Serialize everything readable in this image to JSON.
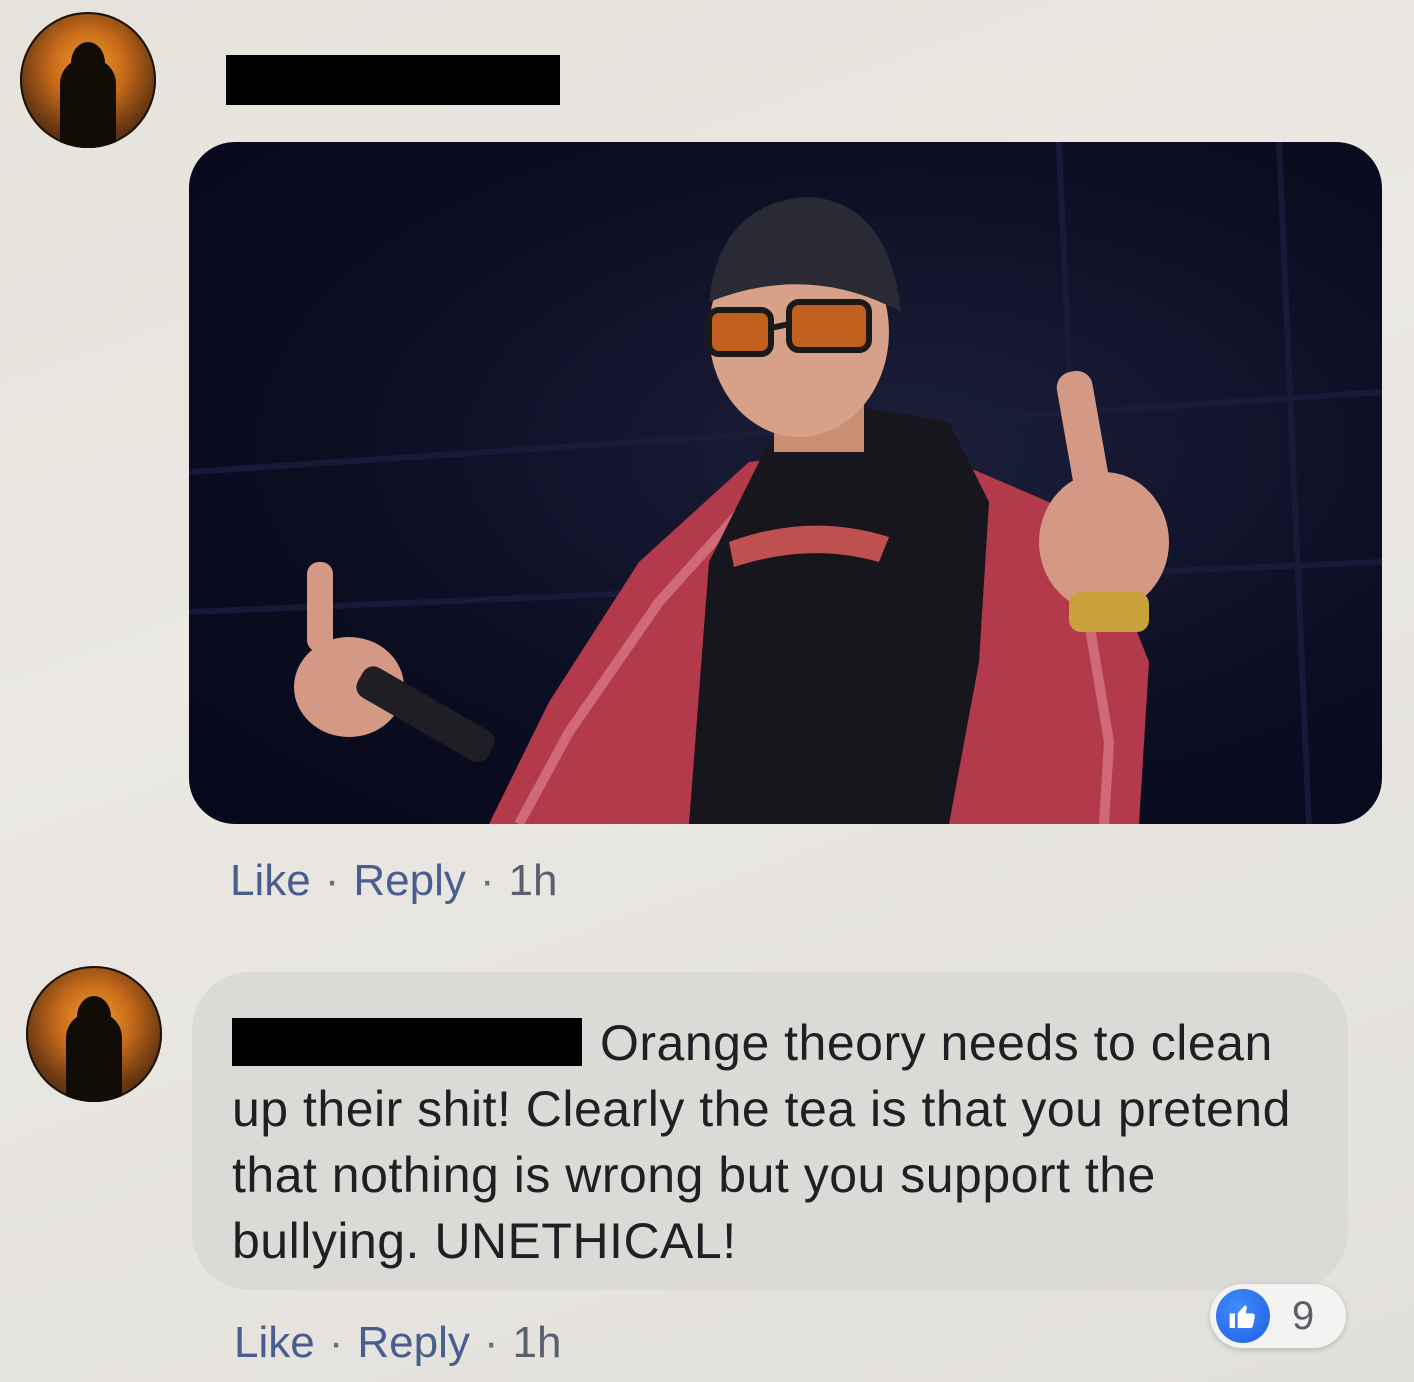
{
  "comments": [
    {
      "actions": {
        "like": "Like",
        "separator": "·",
        "reply": "Reply",
        "time": "1h"
      }
    },
    {
      "text": "Orange theory needs to clean up their shit! Clearly the tea is that you pretend that nothing is wrong but you support the bullying. UNETHICAL!",
      "actions": {
        "like": "Like",
        "separator": "·",
        "reply": "Reply",
        "time": "1h"
      },
      "reactions": {
        "icon": "thumbs-up-icon",
        "count": "9"
      }
    }
  ],
  "colors": {
    "link": "#4a5d8f",
    "bubble": "#dcdad7",
    "like_blue": "#1f5fe0",
    "redaction": "#000000"
  }
}
